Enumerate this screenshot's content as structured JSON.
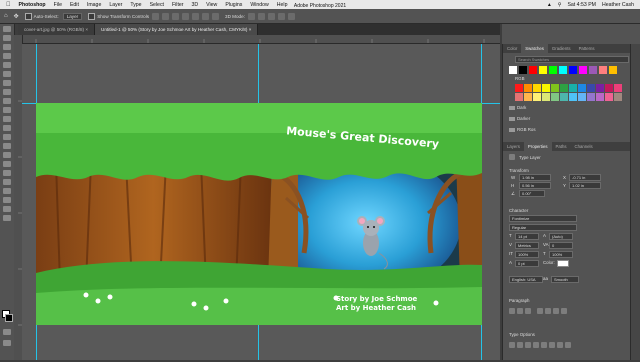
{
  "menubar": {
    "app": "Photoshop",
    "items": [
      "File",
      "Edit",
      "Image",
      "Layer",
      "Type",
      "Select",
      "Filter",
      "3D",
      "View",
      "Plugins",
      "Window",
      "Help"
    ],
    "clock": "Sat 4:53 PM",
    "user": "Heather Cash"
  },
  "options": {
    "auto_select": "Auto-Select:",
    "layer_value": "Layer",
    "transform": "Show Transform Controls",
    "mode": "3D Mode:"
  },
  "window_title": "Adobe Photoshop 2021",
  "tabs": [
    {
      "label": "cover-art.jpg @ 50% (RGB/8)"
    },
    {
      "label": "Untitled-1 @ 50% (Story by Joe Schmoe Art by Heather Cash, CMYK/8)"
    }
  ],
  "artwork": {
    "title": "Mouse's Great Discovery",
    "credit_1": "Story by Joe Schmoe",
    "credit_2": "Art by Heather Cash"
  },
  "swatches": {
    "tabs": [
      "Color",
      "Swatches",
      "Gradients",
      "Patterns"
    ],
    "search_placeholder": "Search Swatches",
    "groups": [
      "RGB",
      "Dark",
      "Darker",
      "RGB Ros"
    ],
    "colors_top": [
      "#ffffff",
      "#000000",
      "#ff0000",
      "#ffff00",
      "#00ff00",
      "#00ffff",
      "#0000ff",
      "#ff00ff",
      "#9b59b6",
      "#ff7f7f",
      "#ffbf00"
    ],
    "colors_rgb": [
      "#ff1a1a",
      "#ff8c00",
      "#ffd700",
      "#f7f700",
      "#80c41c",
      "#2ea043",
      "#1ab0a8",
      "#1e88e5",
      "#3949ab",
      "#7b1fa2",
      "#c2185b",
      "#ec407a"
    ],
    "colors_rgb2": [
      "#e57373",
      "#ffb74d",
      "#fff176",
      "#dce775",
      "#81c784",
      "#4db6ac",
      "#4fc3f7",
      "#64b5f6",
      "#9575cd",
      "#ba68c8",
      "#f06292",
      "#a1887f"
    ]
  },
  "properties": {
    "tabs": [
      "Layers",
      "Properties",
      "Paths",
      "Channels"
    ],
    "layer_kind": "Type Layer",
    "transform_label": "Transform",
    "w": "1.98 in",
    "x": "-0.71 in",
    "h": "0.56 in",
    "y": "1.02 in",
    "angle": "0.00°",
    "character_label": "Character",
    "font": "Fontimize",
    "style": "Regular",
    "size": "14 pt",
    "leading": "(Auto)",
    "tracking": "0",
    "kerning": "Metrics",
    "scale_v": "100%",
    "scale_h": "100%",
    "baseline": "0 pt",
    "language": "English: USA",
    "aa": "Smooth",
    "paragraph_label": "Paragraph",
    "type_options_label": "Type Options"
  }
}
